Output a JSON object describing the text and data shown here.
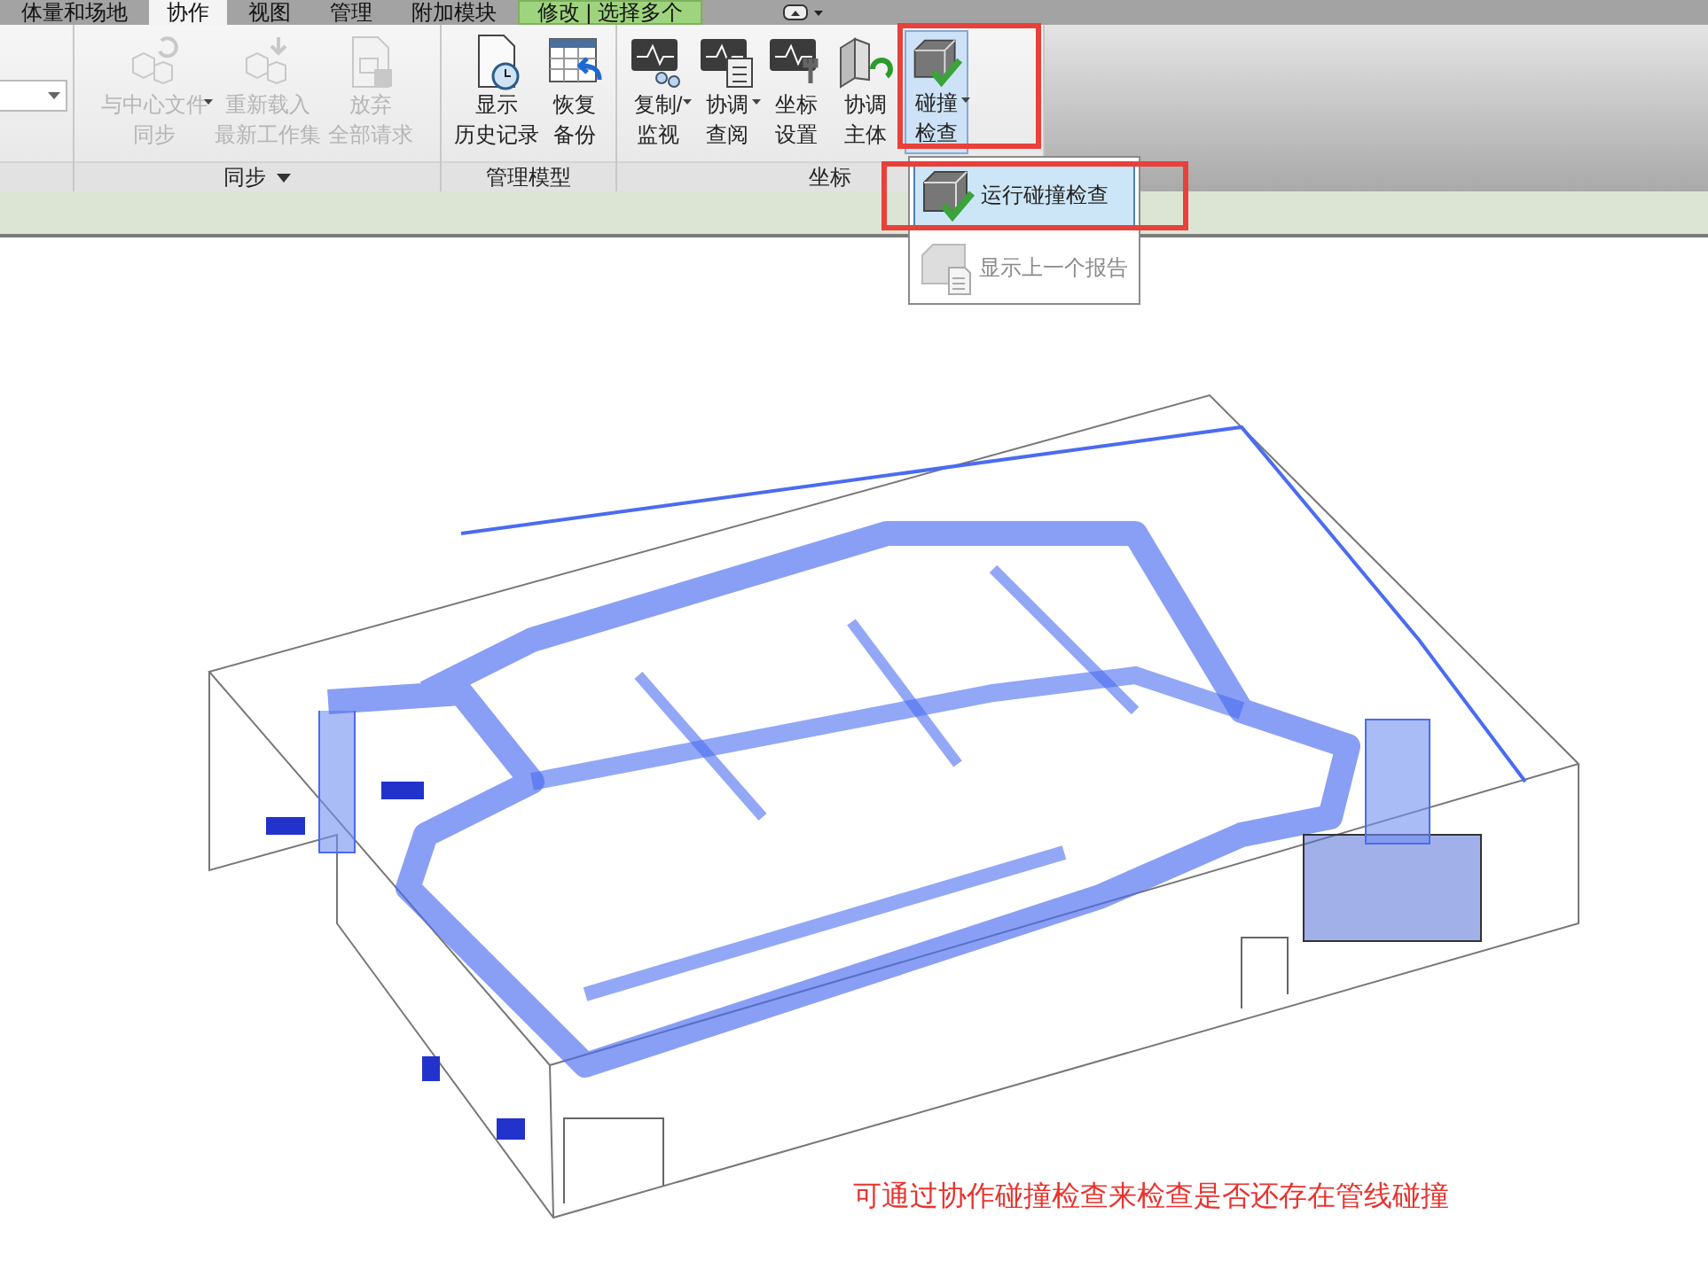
{
  "tabs": [
    {
      "label": "体量和场地",
      "selected": false,
      "kind": "normal"
    },
    {
      "label": "协作",
      "selected": true,
      "kind": "normal"
    },
    {
      "label": "视图",
      "selected": false,
      "kind": "normal"
    },
    {
      "label": "管理",
      "selected": false,
      "kind": "normal"
    },
    {
      "label": "附加模块",
      "selected": false,
      "kind": "normal"
    },
    {
      "label": "修改 | 选择多个",
      "selected": false,
      "kind": "contextual"
    }
  ],
  "panels": [
    {
      "label": "同步",
      "menu": true,
      "buttons": [
        {
          "lines": [
            "与中心文件",
            "同步"
          ],
          "disabled": true,
          "dropdown": true,
          "selected": false
        },
        {
          "lines": [
            "重新载入",
            "最新工作集"
          ],
          "disabled": true,
          "dropdown": false,
          "selected": false
        },
        {
          "lines": [
            "放弃",
            "全部请求"
          ],
          "disabled": true,
          "dropdown": false,
          "selected": false
        }
      ]
    },
    {
      "label": "管理模型",
      "menu": false,
      "buttons": [
        {
          "lines": [
            "显示",
            "历史记录"
          ],
          "disabled": false,
          "dropdown": false,
          "selected": false
        },
        {
          "lines": [
            "恢复",
            "备份"
          ],
          "disabled": false,
          "dropdown": false,
          "selected": false
        }
      ]
    },
    {
      "label": "坐标",
      "menu": false,
      "buttons": [
        {
          "lines": [
            "复制/",
            "监视"
          ],
          "disabled": false,
          "dropdown": true,
          "selected": false
        },
        {
          "lines": [
            "协调",
            "查阅"
          ],
          "disabled": false,
          "dropdown": true,
          "selected": false
        },
        {
          "lines": [
            "坐标",
            "设置"
          ],
          "disabled": false,
          "dropdown": false,
          "selected": false
        },
        {
          "lines": [
            "协调",
            "主体"
          ],
          "disabled": false,
          "dropdown": false,
          "selected": false
        },
        {
          "lines": [
            "碰撞",
            "检查"
          ],
          "disabled": false,
          "dropdown": true,
          "selected": true
        }
      ]
    }
  ],
  "menu": {
    "items": [
      {
        "label": "运行碰撞检查",
        "selected": true,
        "disabled": false
      },
      {
        "label": "显示上一个报告",
        "selected": false,
        "disabled": true
      }
    ]
  },
  "caption": "可通过协作碰撞检查来检查是否还存在管线碰撞"
}
